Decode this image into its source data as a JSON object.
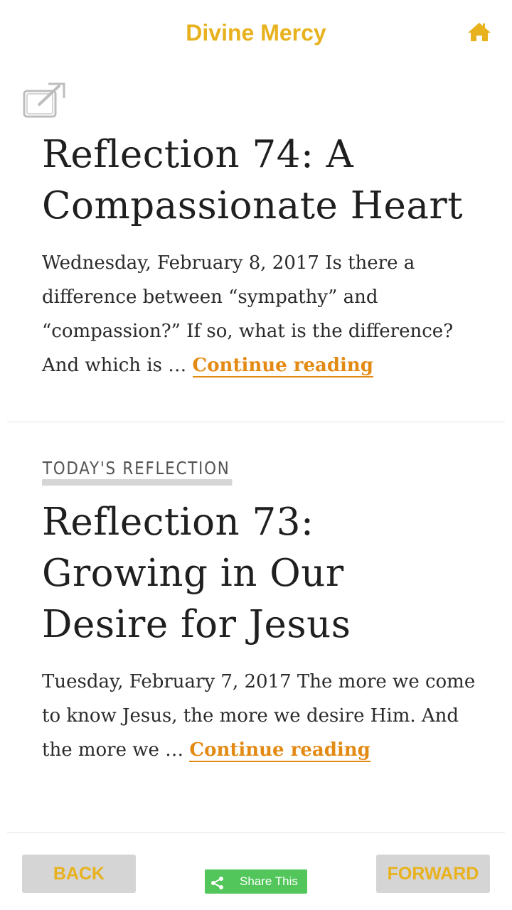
{
  "header": {
    "title": "Divine Mercy",
    "home_icon": "home-icon",
    "accent_color": "#E8B11E"
  },
  "articles": [
    {
      "category": "",
      "title": "Reflection 74: A Compassionate Heart",
      "excerpt": "Wednesday, February 8, 2017 Is there a difference between “sympathy” and “compassion?”  If so, what is the difference? And which is …",
      "link_label": "Continue reading"
    },
    {
      "category": "TODAY'S REFLECTION",
      "title": "Reflection 73: Growing in Our Desire for Jesus",
      "excerpt": "Tuesday, February 7, 2017 The more we come to know Jesus, the more we desire Him.  And the more we …",
      "link_label": "Continue reading"
    }
  ],
  "footer": {
    "back_label": "BACK",
    "share_label": "Share This",
    "forward_label": "FORWARD",
    "share_color": "#52c65a",
    "link_color": "#E38A14"
  },
  "icons": {
    "external": "open-external-icon",
    "share": "share-icon"
  }
}
